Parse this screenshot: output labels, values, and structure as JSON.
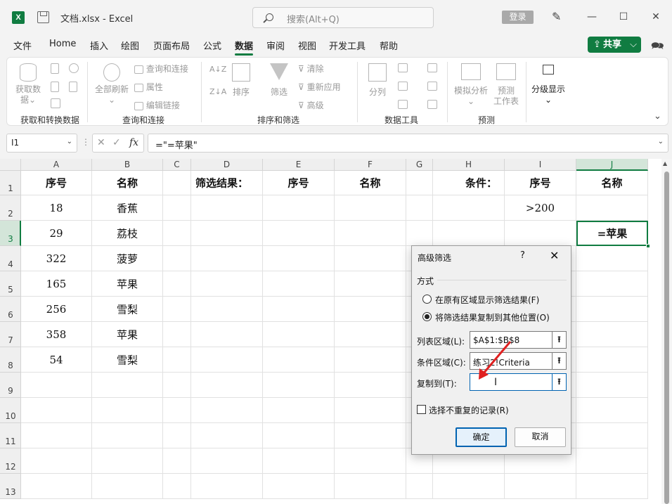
{
  "titlebar": {
    "app_logo": "X",
    "title": "文档.xlsx  -  Excel",
    "search_placeholder": "搜索(Alt+Q)",
    "login_label": "登录",
    "minimize": "—",
    "maximize": "☐",
    "close": "✕",
    "icons": [
      "excel-logo-icon",
      "save-icon",
      "search-icon",
      "designer-pen-icon"
    ]
  },
  "menu": {
    "items": [
      "文件",
      "Home",
      "插入",
      "绘图",
      "页面布局",
      "公式",
      "数据",
      "审阅",
      "视图",
      "开发工具",
      "帮助"
    ],
    "active": "数据",
    "share_label": "共享",
    "share_chevron": "⌵"
  },
  "ribbon": {
    "groups": {
      "get_data": {
        "label": "获取和转换数据",
        "get_data_btn_line1": "获取数",
        "get_data_btn_line2": "据⌄"
      },
      "queries": {
        "label": "查询和连接",
        "refresh_line1": "全部刷新",
        "refresh_line2": "⌄",
        "queries_connections": "查询和连接",
        "properties": "属性",
        "edit_links": "编辑链接"
      },
      "sort_filter": {
        "label": "排序和筛选",
        "sort_az": "A↓Z",
        "sort_za": "Z↓A",
        "sort": "排序",
        "filter": "筛选",
        "clear": "清除",
        "reapply": "重新应用",
        "advanced": "高级"
      },
      "data_tools": {
        "label": "数据工具",
        "text_to_columns": "分列"
      },
      "forecast": {
        "label": "预测",
        "what_if_line1": "模拟分析",
        "what_if_line2": "⌄",
        "forecast_sheet_line1": "预测",
        "forecast_sheet_line2": "工作表"
      },
      "outline": {
        "label": "分级显示",
        "chevron": "⌄"
      }
    },
    "collapse": "⌄"
  },
  "formula_bar": {
    "name_box": "I1",
    "cancel": "✕",
    "confirm": "✓",
    "fx": "fx",
    "formula": "=\"=苹果\""
  },
  "sheet": {
    "columns": [
      "A",
      "B",
      "C",
      "D",
      "E",
      "F",
      "G",
      "H",
      "I",
      "J"
    ],
    "selected_column": "J",
    "row_numbers": [
      "1",
      "2",
      "3",
      "4",
      "5",
      "6",
      "7",
      "8",
      "9",
      "10",
      "11",
      "12",
      "13"
    ],
    "selected_row": "3",
    "cells": {
      "A1": "序号",
      "B1": "名称",
      "D1": "筛选结果：",
      "E1": "序号",
      "F1": "名称",
      "H1": "条件：",
      "I1": "序号",
      "J1": "名称",
      "A2": "18",
      "B2": "香蕉",
      "I2": ">200",
      "A3": "29",
      "B3": "荔枝",
      "J3": "=苹果",
      "A4": "322",
      "B4": "菠萝",
      "A5": "165",
      "B5": "苹果",
      "A6": "256",
      "B6": "雪梨",
      "A7": "358",
      "B7": "苹果",
      "A8": "54",
      "B8": "雪梨"
    },
    "active_cell": "J3"
  },
  "dialog": {
    "title": "高级筛选",
    "help": "?",
    "close": "✕",
    "section": "方式",
    "option1": "在原有区域显示筛选结果(F)",
    "option2": "将筛选结果复制到其他位置(O)",
    "selected_option": 2,
    "list_range_label": "列表区域(L):",
    "list_range_value": "$A$1:$B$8",
    "criteria_range_label": "条件区域(C):",
    "criteria_range_value": "练习2!Criteria",
    "copy_to_label": "复制到(T):",
    "copy_to_value": "",
    "unique_label": "选择不重复的记录(R)",
    "unique_checked": false,
    "ok": "确定",
    "cancel": "取消",
    "collapse_icon": "⭱",
    "cursor": "I"
  },
  "colors": {
    "brand": "#107c41",
    "annotation_arrow": "#e02020",
    "dialog_focus": "#0063b1"
  }
}
